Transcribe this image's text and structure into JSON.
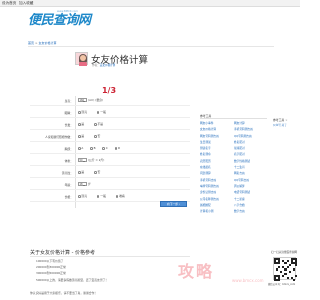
{
  "topbar": {
    "links": [
      "设为首页",
      "加入收藏"
    ]
  },
  "header": {
    "logo_text": "便民查询网",
    "logo_url": "www.BMCX.com"
  },
  "breadcrumb": {
    "home": "首页",
    "sep": ">",
    "current": "女友价格计算"
  },
  "title": {
    "text": "女友价格计算",
    "author_prefix": "作者：",
    "author_name": "美女价格计算"
  },
  "progress": "1/3",
  "form": {
    "rows": [
      {
        "label": "身高：",
        "select": "160",
        "suffix": "(cm) (量身)"
      },
      {
        "label": "眼睛：",
        "options": [
          "漂亮",
          "一般"
        ]
      },
      {
        "label": "长发：",
        "options": [
          "是",
          "不是"
        ]
      },
      {
        "label": "人家和我们照相作做：",
        "options": [
          "是",
          "否"
        ]
      },
      {
        "label": "胸部：",
        "options": [
          "A",
          "B",
          "C",
          "D"
        ]
      },
      {
        "label": "体重：",
        "select": "50",
        "suffix": "(公斤 = 2斤)"
      },
      {
        "label": "漂亮性：",
        "options": [
          "是",
          "否"
        ]
      },
      {
        "label": "年龄：",
        "select": "18",
        "suffix": "岁"
      },
      {
        "label": "长相：",
        "options": [
          "漂亮",
          "一般",
          "难看"
        ]
      }
    ],
    "next_label": "向下一步 ›"
  },
  "about": {
    "title": "关于女友价格计算 - 价格参考",
    "items": [
      "100000以下有价值了",
      "200000到300000正常",
      "300000到500000正常",
      "500000以上的，请要多练做漂亮脸型，还了宝贵友男了！"
    ],
    "more": "你认识好是用于大家娱乐，请不要当了真，谢谢合作！"
  },
  "sidebar": {
    "head": "参考工具",
    "links": [
      "网友小事件",
      "网友计算",
      "女友价格计算",
      "手机号码测吉凶",
      "网友号码测吉凶",
      "QQ号码测吉凶",
      "生日测试",
      "姓名配对",
      "测试名字",
      "星座配对",
      "姓名测命",
      "名字配对",
      "农历阳历",
      "数字性格测试",
      "在线起名",
      "十二生肖",
      "问卦测算",
      "网名吉凶",
      "手机号码吉凶",
      "QQ号码吉凶",
      "车牌号码测吉凶",
      "周公解梦",
      "身份证测吉凶",
      "电话号码测试",
      "公司名称测吉凶",
      "十二星座",
      "属相婚配",
      "八字合婚",
      "计算机小测",
      "数字吉凶"
    ]
  },
  "floating": {
    "title": "参考工具",
    "close": "×",
    "link": "公众号·对了"
  },
  "qr": {
    "caption_top": "扫一扫关注便民查询网",
    "caption_bottom": "微信公众号：bmcx_com"
  },
  "watermark": {
    "text": "攻略",
    "sub": "www.bmcx.com"
  },
  "colors": {
    "accent": "#1e88c9",
    "progress": "#cc2233",
    "link": "#1a66b8",
    "button": "#4f8fd6"
  }
}
